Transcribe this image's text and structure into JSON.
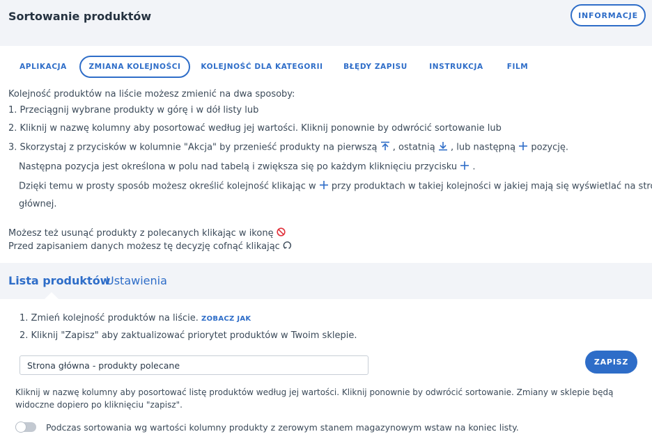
{
  "header": {
    "title": "Sortowanie produktów",
    "info_button": "INFORMACJE"
  },
  "tabs": [
    {
      "label": "APLIKACJA"
    },
    {
      "label": "ZMIANA KOLEJNOŚCI"
    },
    {
      "label": "KOLEJNOŚĆ DLA KATEGORII"
    },
    {
      "label": "BŁĘDY ZAPISU"
    },
    {
      "label": "INSTRUKCJA"
    },
    {
      "label": "FILM"
    }
  ],
  "instructions": {
    "intro": "Kolejność produktów na liście możesz zmienić na dwa sposoby:",
    "step1": "1. Przeciągnij wybrane produkty w górę i w dół listy lub",
    "step2": "2. Kliknij w nazwę kolumny aby posortować według jej wartości. Kliknij ponownie by odwrócić sortowanie lub",
    "step3_a": "3. Skorzystaj z przycisków w kolumnie \"Akcja\" by przenieść produkty na pierwszą",
    "step3_b": ", ostatnią",
    "step3_c": ", lub następną",
    "step3_d": "pozycję.",
    "next_a": "Następna pozycja jest określona w polu nad tabelą i zwiększa się po każdym kliknięciu przycisku",
    "next_b": ".",
    "thanks_a": "Dzięki temu w prosty sposób możesz określić kolejność klikając w",
    "thanks_b": "przy produktach w takiej kolejności w jakiej mają się wyświetlać na stronie",
    "thanks_c": "głównej.",
    "remove": "Możesz też usunąć produkty z polecanych klikając w ikonę",
    "undo": "Przed zapisaniem danych możesz tę decyzję cofnąć klikając"
  },
  "subtabs": [
    {
      "label": "Lista produktów"
    },
    {
      "label": "Ustawienia"
    }
  ],
  "steps": {
    "step1": "1. Zmień kolejność produktów na liście.",
    "step1_link": "ZOBACZ JAK",
    "step2": "2. Kliknij \"Zapisz\" aby zaktualizować priorytet produktów w Twoim sklepie."
  },
  "select": {
    "value": "Strona główna - produkty polecane"
  },
  "save_button": "ZAPISZ",
  "note": "Kliknij w nazwę kolumny aby posortować listę produktów według jej wartości. Kliknij ponownie by odwrócić sortowanie. Zmiany w sklepie będą widoczne dopiero po kliknięciu \"zapisz\".",
  "toggle": {
    "label": "Podczas sortowania wg wartości kolumny produkty z zerowym stanem magazynowym wstaw na koniec listy.",
    "on": false
  },
  "colors": {
    "accent": "#2e6dc8",
    "header_bg": "#f2f4f8",
    "danger": "#e0333d"
  },
  "icons": [
    "move-top-icon",
    "move-bottom-icon",
    "plus-icon",
    "ban-icon",
    "undo-icon"
  ]
}
